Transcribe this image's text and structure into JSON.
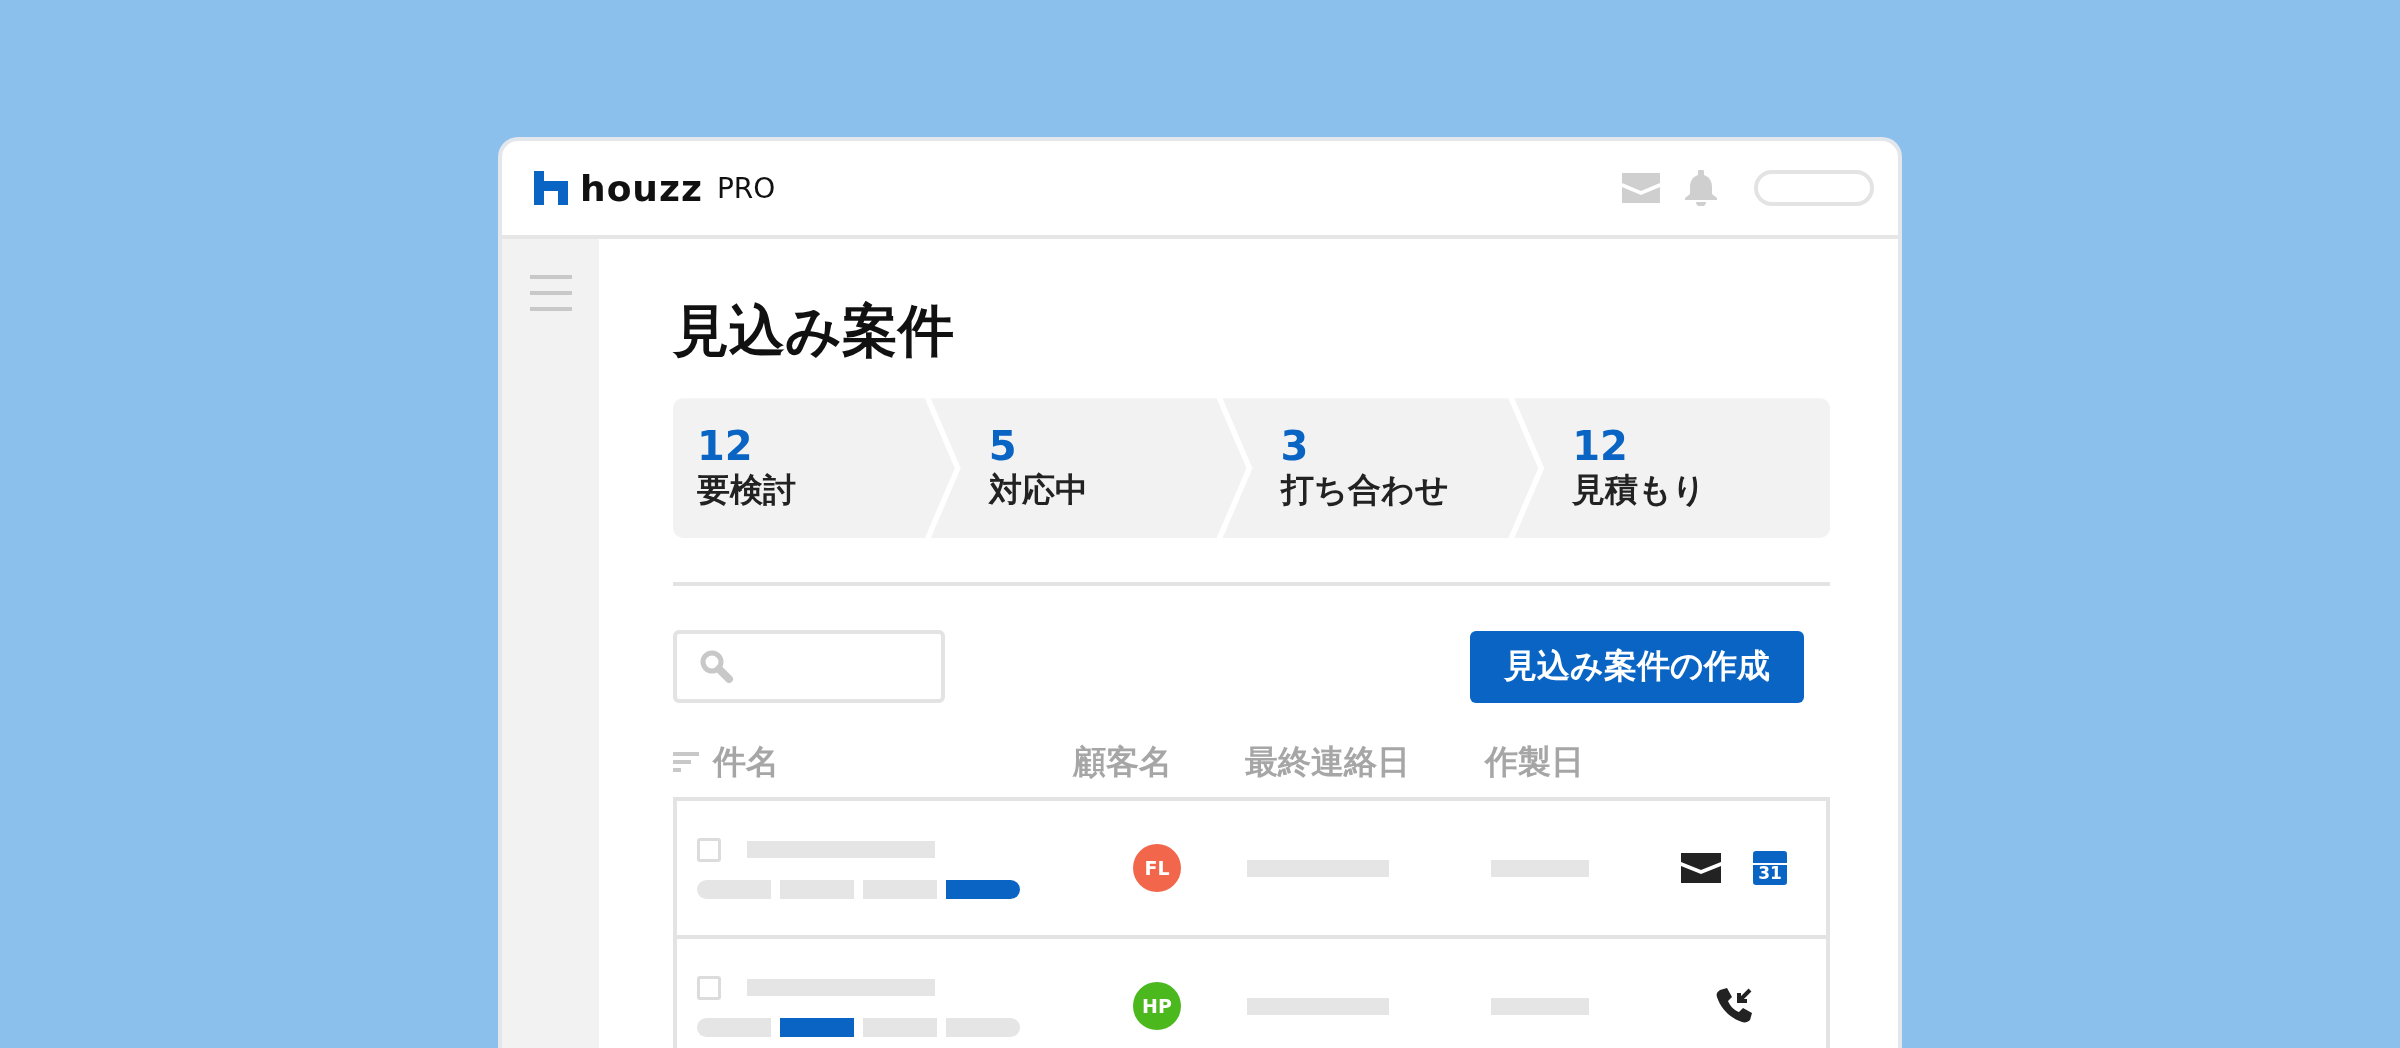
{
  "header": {
    "logo": "houzz",
    "logo_suffix": "PRO"
  },
  "page_title": "見込み案件",
  "pipeline": [
    {
      "count": "12",
      "label": "要検討"
    },
    {
      "count": "5",
      "label": "対応中"
    },
    {
      "count": "3",
      "label": "打ち合わせ"
    },
    {
      "count": "12",
      "label": "見積もり"
    }
  ],
  "create_button": "見込み案件の作成",
  "table": {
    "columns": [
      "件名",
      "顧客名",
      "最終連絡日",
      "作製日"
    ],
    "rows": [
      {
        "checked": false,
        "stages": [
          {
            "selected": false
          },
          {
            "selected": false
          },
          {
            "selected": false
          },
          {
            "selected": true
          }
        ],
        "client": {
          "initials": "FL",
          "color": "#f2674b"
        },
        "actions": [
          {
            "kind": "mail"
          },
          {
            "kind": "calendar",
            "label": "31"
          }
        ]
      },
      {
        "checked": false,
        "stages": [
          {
            "selected": false
          },
          {
            "selected": true
          },
          {
            "selected": false
          },
          {
            "selected": false
          }
        ],
        "client": {
          "initials": "HP",
          "color": "#4bb81e"
        },
        "actions": [
          {
            "kind": "phone"
          }
        ]
      }
    ]
  }
}
